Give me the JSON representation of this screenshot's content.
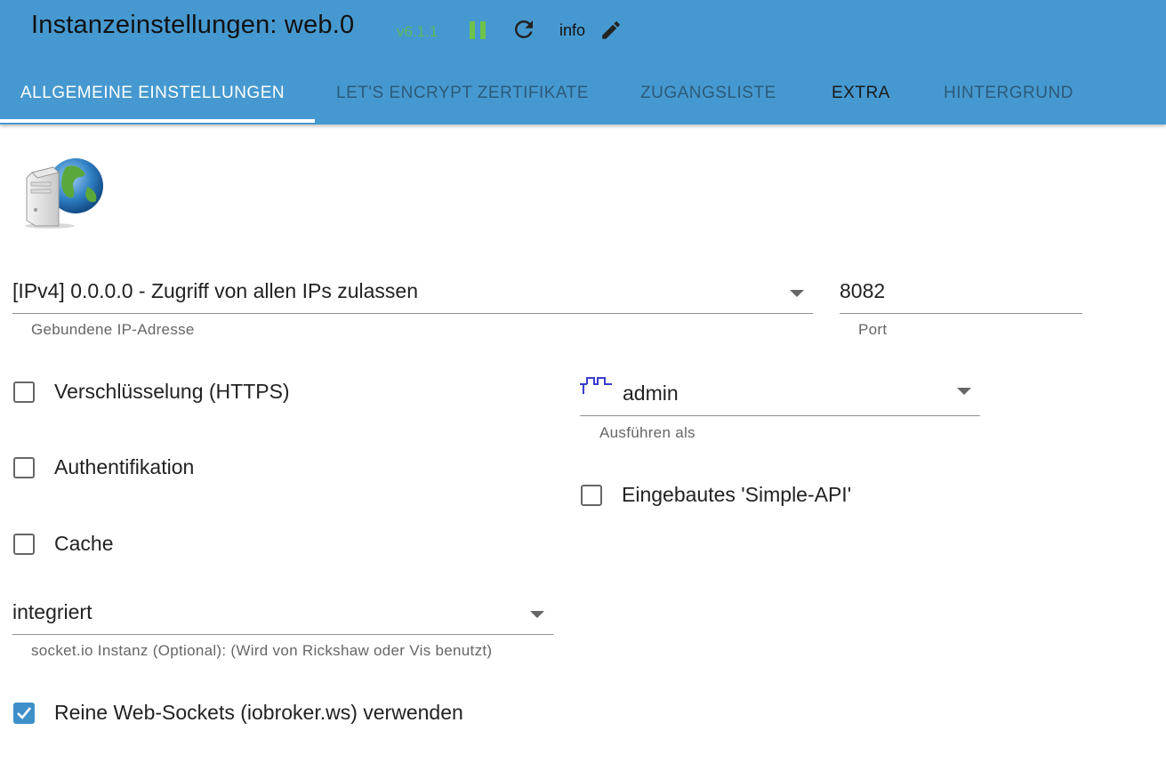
{
  "header": {
    "title": "Instanzeinstellungen: web.0",
    "version": "v6.1.1",
    "info_label": "info",
    "colors": {
      "bar": "#4699d0",
      "version": "#5cb85c"
    }
  },
  "tabs": [
    {
      "label": "ALLGEMEINE EINSTELLUNGEN",
      "active": true
    },
    {
      "label": "LET'S ENCRYPT ZERTIFIKATE",
      "active": false
    },
    {
      "label": "ZUGANGSLISTE",
      "active": false
    },
    {
      "label": "EXTRA",
      "active": false
    },
    {
      "label": "HINTERGRUND",
      "active": false
    }
  ],
  "form": {
    "bind_ip": {
      "value": "[IPv4] 0.0.0.0 - Zugriff von allen IPs zulassen",
      "helper": "Gebundene IP-Adresse"
    },
    "port": {
      "value": "8082",
      "helper": "Port"
    },
    "https": {
      "label": "Verschlüsselung (HTTPS)",
      "checked": false
    },
    "run_as": {
      "value": "admin",
      "helper": "Ausführen als"
    },
    "auth": {
      "label": "Authentifikation",
      "checked": false
    },
    "simple_api": {
      "label": "Eingebautes 'Simple-API'",
      "checked": false
    },
    "cache": {
      "label": "Cache",
      "checked": false
    },
    "socketio": {
      "value": "integriert",
      "helper": "socket.io Instanz (Optional): (Wird von Rickshaw oder Vis benutzt)"
    },
    "websockets": {
      "label": "Reine Web-Sockets (iobroker.ws) verwenden",
      "checked": true
    }
  }
}
